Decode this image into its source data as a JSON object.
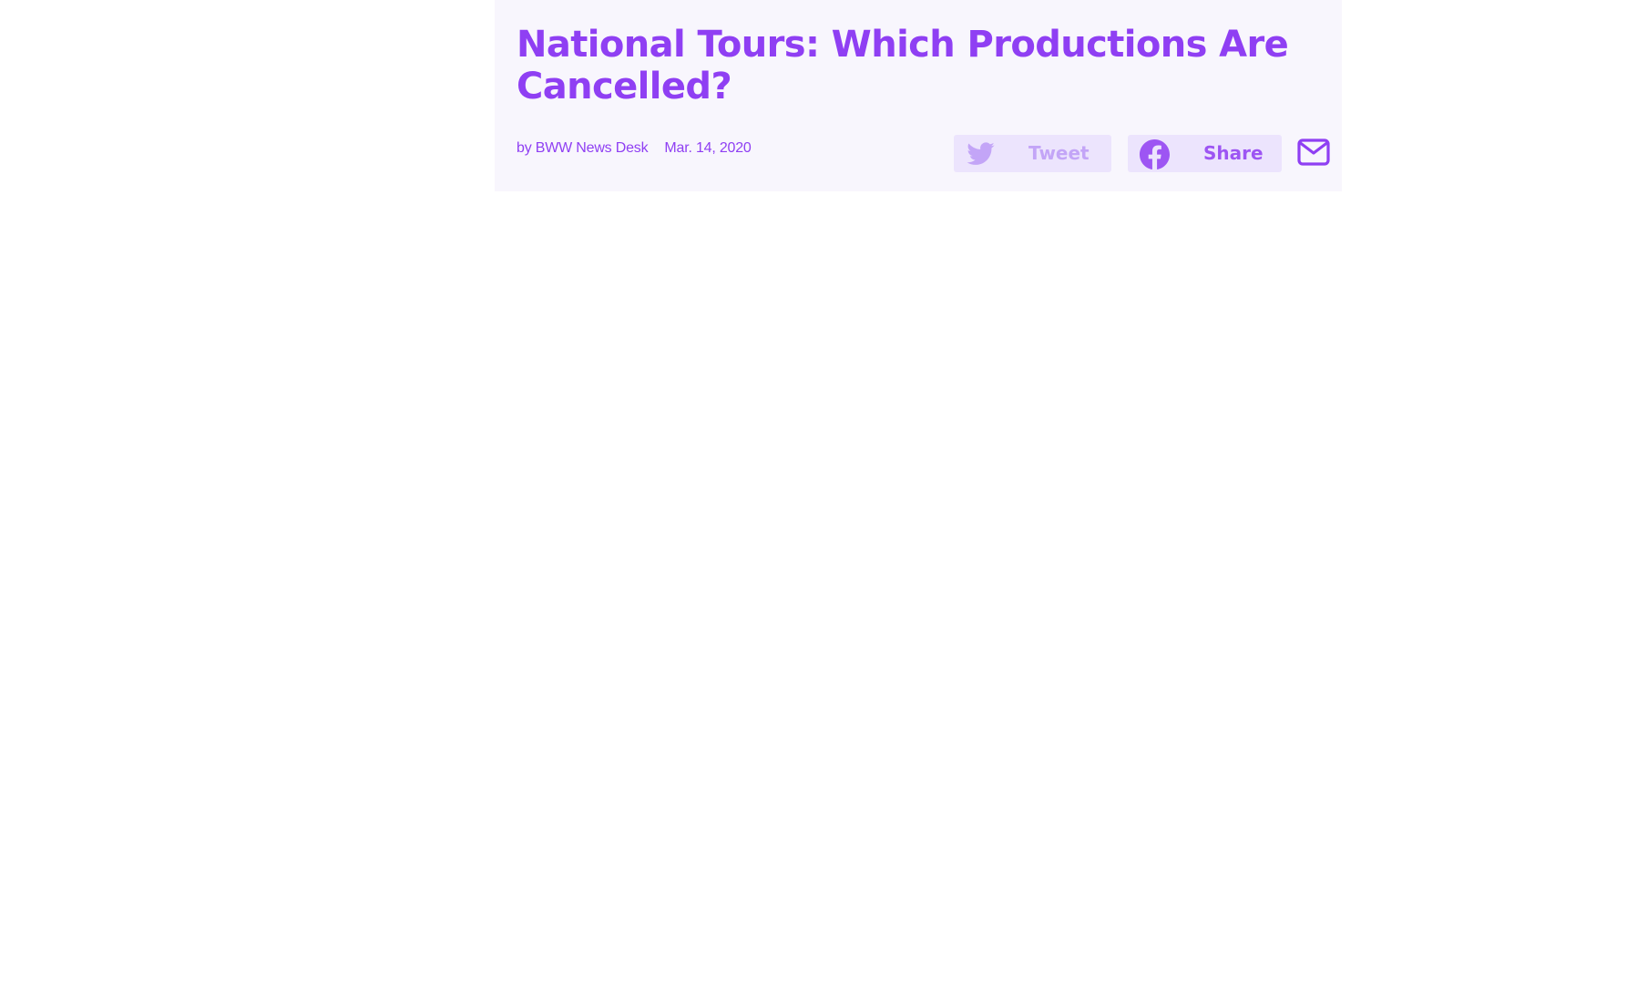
{
  "article": {
    "title": "National Tours: Which Productions Are Cancelled?",
    "byline": "by BWW News Desk",
    "date": "Mar. 14, 2020"
  },
  "share": {
    "tweet_label": "Tweet",
    "facebook_label": "Share",
    "icons": {
      "tweet": "twitter-bird-icon",
      "facebook": "facebook-icon",
      "email": "envelope-icon"
    }
  },
  "colors": {
    "accent": "#8f3ff3",
    "header_bg": "#f8f6fd",
    "button_bg": "#ece4fd",
    "tweet_muted": "#c3a5f7",
    "facebook_icon": "#9d55f3"
  }
}
